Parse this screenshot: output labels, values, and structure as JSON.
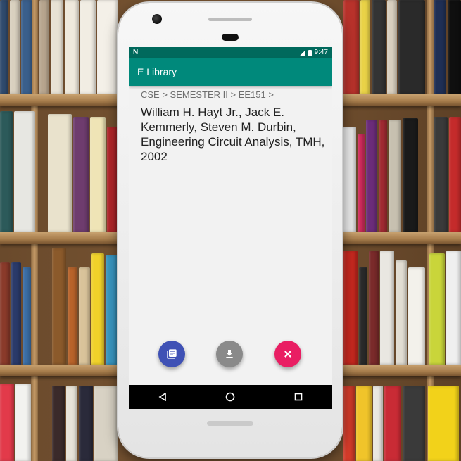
{
  "status_bar": {
    "time": "9:47",
    "left_icon": "N"
  },
  "app_bar": {
    "title": "E Library"
  },
  "breadcrumb": "CSE > SEMESTER II > EE151 >",
  "book": {
    "citation": "William H. Hayt Jr., Jack E. Kemmerly, Steven M. Durbin, Engineering Circuit Analysis, TMH, 2002"
  },
  "fabs": [
    {
      "name": "library",
      "icon": "library-books-icon",
      "color": "#3f51b5"
    },
    {
      "name": "download",
      "icon": "download-icon",
      "color": "#8a8a8a"
    },
    {
      "name": "close",
      "icon": "close-icon",
      "color": "#e91e63"
    }
  ],
  "theme": {
    "primary": "#00897b",
    "primary_dark": "#00695c"
  }
}
